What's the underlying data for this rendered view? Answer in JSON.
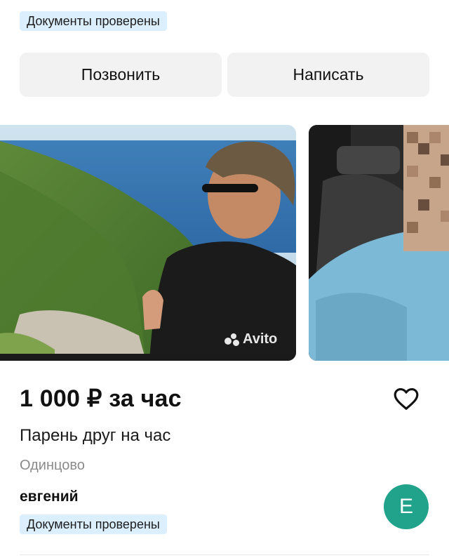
{
  "top_badge": "Документы проверены",
  "actions": {
    "call_label": "Позвонить",
    "write_label": "Написать"
  },
  "gallery": {
    "watermark": "Avito"
  },
  "listing": {
    "price": "1 000 ₽ за час",
    "title": "Парень друг на час",
    "location": "Одинцово"
  },
  "seller": {
    "name": "евгений",
    "badge": "Документы проверены",
    "avatar_letter": "Е"
  },
  "colors": {
    "badge_bg": "#dcefff",
    "button_bg": "#f2f2f2",
    "avatar_bg": "#21a38b"
  }
}
